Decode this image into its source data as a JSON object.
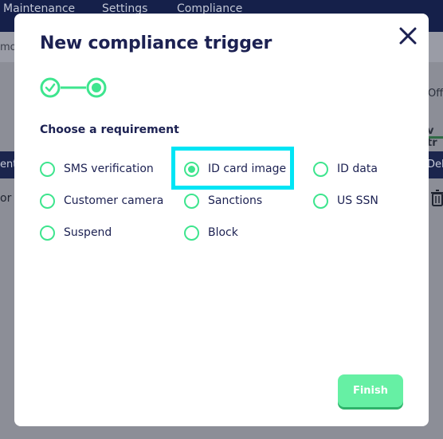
{
  "background": {
    "nav_items": [
      "Maintenance",
      "Settings",
      "Compliance"
    ],
    "subbar_text": "mo",
    "right_texts": [
      "Off",
      "v tr"
    ],
    "table_header_left": "ent",
    "table_header_right": "Del",
    "row_left_text": "or :"
  },
  "modal": {
    "title": "New compliance trigger",
    "section_label": "Choose a requirement",
    "options": [
      {
        "label": "SMS verification",
        "checked": false
      },
      {
        "label": "ID card image",
        "checked": true
      },
      {
        "label": "ID data",
        "checked": false
      },
      {
        "label": "Customer camera",
        "checked": false
      },
      {
        "label": "Sanctions",
        "checked": false
      },
      {
        "label": "US SSN",
        "checked": false
      },
      {
        "label": "Suspend",
        "checked": false
      },
      {
        "label": "Block",
        "checked": false
      }
    ],
    "finish_label": "Finish",
    "icons": {
      "close": "close-icon",
      "step1": "check-circle-icon",
      "step2": "dot-circle-icon",
      "delete": "trash-icon"
    },
    "colors": {
      "accent": "#3ee58e",
      "title": "#1c2152",
      "highlight": "#00e5f5",
      "finish_bg": "#66f0a4"
    }
  }
}
